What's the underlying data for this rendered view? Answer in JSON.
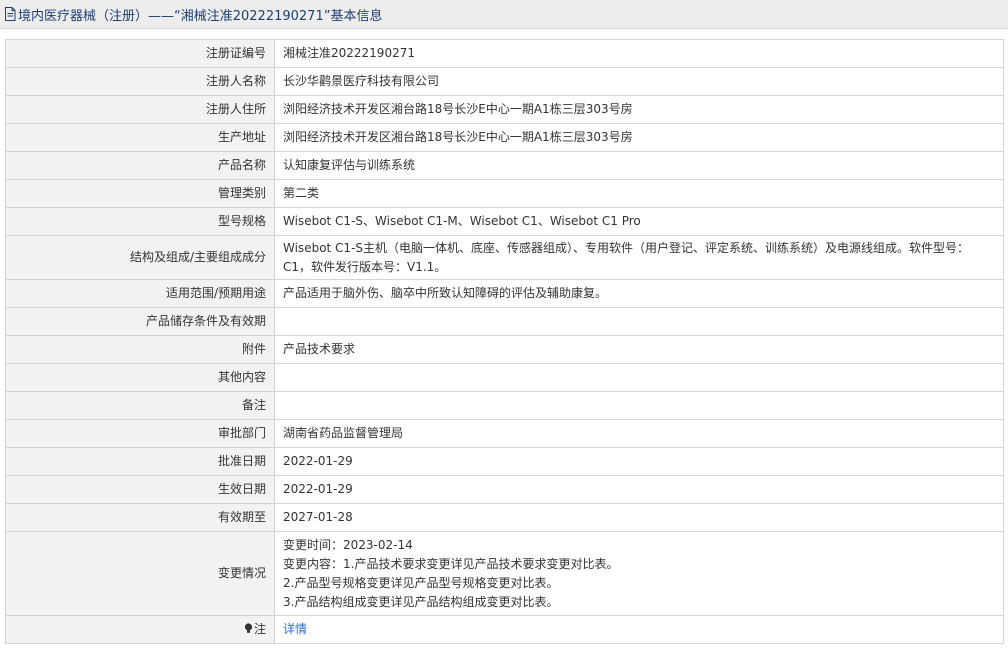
{
  "header": {
    "title": "境内医疗器械（注册）——“湘械注准20222190271”基本信息"
  },
  "rows": [
    {
      "label": "注册证编号",
      "value": "湘械注准20222190271"
    },
    {
      "label": "注册人名称",
      "value": "长沙华鹳景医疗科技有限公司"
    },
    {
      "label": "注册人住所",
      "value": "浏阳经济技术开发区湘台路18号长沙E中心一期A1栋三层303号房"
    },
    {
      "label": "生产地址",
      "value": "浏阳经济技术开发区湘台路18号长沙E中心一期A1栋三层303号房"
    },
    {
      "label": "产品名称",
      "value": "认知康复评估与训练系统"
    },
    {
      "label": "管理类别",
      "value": "第二类"
    },
    {
      "label": "型号规格",
      "value": "Wisebot C1-S、Wisebot C1-M、Wisebot C1、Wisebot C1 Pro"
    },
    {
      "label": "结构及组成/主要组成成分",
      "value": "Wisebot C1-S主机（电脑一体机、底座、传感器组成）、专用软件（用户登记、评定系统、训练系统）及电源线组成。软件型号：C1，软件发行版本号：V1.1。"
    },
    {
      "label": "适用范围/预期用途",
      "value": "产品适用于脑外伤、脑卒中所致认知障碍的评估及辅助康复。"
    },
    {
      "label": "产品储存条件及有效期",
      "value": ""
    },
    {
      "label": "附件",
      "value": "产品技术要求"
    },
    {
      "label": "其他内容",
      "value": ""
    },
    {
      "label": "备注",
      "value": ""
    },
    {
      "label": "审批部门",
      "value": "湖南省药品监督管理局"
    },
    {
      "label": "批准日期",
      "value": "2022-01-29"
    },
    {
      "label": "生效日期",
      "value": "2022-01-29"
    },
    {
      "label": "有效期至",
      "value": "2027-01-28"
    }
  ],
  "change": {
    "label": "变更情况",
    "lines": [
      "变更时间：2023-02-14",
      "变更内容：1.产品技术要求变更详见产品技术要求变更对比表。",
      "2.产品型号规格变更详见产品型号规格变更对比表。",
      "3.产品结构组成变更详见产品结构组成变更对比表。"
    ]
  },
  "note": {
    "label": "注",
    "icon": "lightbulb-icon",
    "link_text": "详情"
  },
  "colors": {
    "title_text": "#1f3f73",
    "label_bg": "#f2f2f2",
    "border": "#d4d4d4",
    "link": "#2a6fcf"
  }
}
